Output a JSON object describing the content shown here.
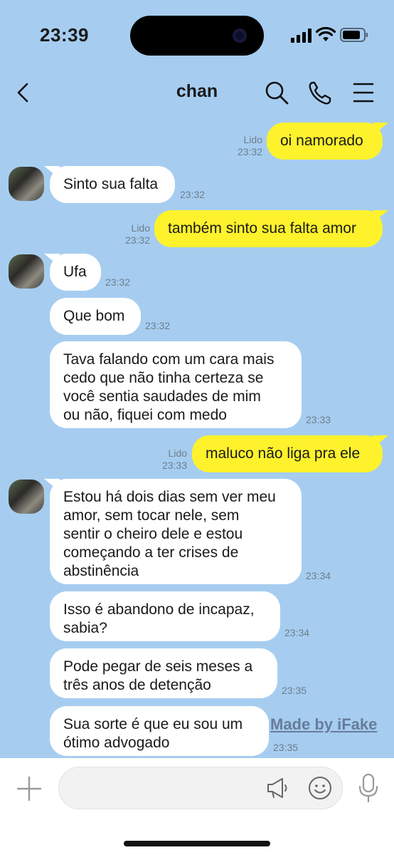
{
  "status_bar": {
    "time": "23:39"
  },
  "header": {
    "title": "chan"
  },
  "messages": [
    {
      "text": "oi namorado",
      "read": "Lido",
      "time": "23:32"
    },
    {
      "text": "Sinto sua falta",
      "time": "23:32"
    },
    {
      "text": "também sinto sua falta amor",
      "read": "Lido",
      "time": "23:32"
    },
    {
      "text": "Ufa",
      "time": "23:32"
    },
    {
      "text": "Que bom",
      "time": "23:32"
    },
    {
      "text": "Tava falando com um cara mais\ncedo que não tinha certeza se\nvocê sentia saudades de mim\nou não, fiquei com medo",
      "time": "23:33"
    },
    {
      "text": "maluco não liga pra ele",
      "read": "Lido",
      "time": "23:33"
    },
    {
      "text": "Estou há dois dias sem ver meu\namor, sem tocar nele, sem\nsentir o cheiro dele e estou\ncomeçando a ter crises de\nabstinência",
      "time": "23:34"
    },
    {
      "text": "Isso é abandono de incapaz,\nsabia?",
      "time": "23:34"
    },
    {
      "text": "Pode pegar de seis meses a\ntrês anos de detenção",
      "time": "23:35"
    },
    {
      "text": "Sua sorte é que eu sou um\nótimo advogado",
      "time": "23:35"
    }
  ],
  "watermark": "Made by iFake",
  "input": {
    "placeholder": ""
  },
  "icons": {
    "back": "chevron-left-icon",
    "search": "search-icon",
    "call": "phone-icon",
    "menu": "menu-icon",
    "plus": "plus-icon",
    "megaphone": "megaphone-icon",
    "emoji": "emoji-icon",
    "mic": "microphone-icon"
  },
  "colors": {
    "background": "#a6cdf0",
    "outgoing_bubble": "#fef22c",
    "incoming_bubble": "#ffffff"
  }
}
